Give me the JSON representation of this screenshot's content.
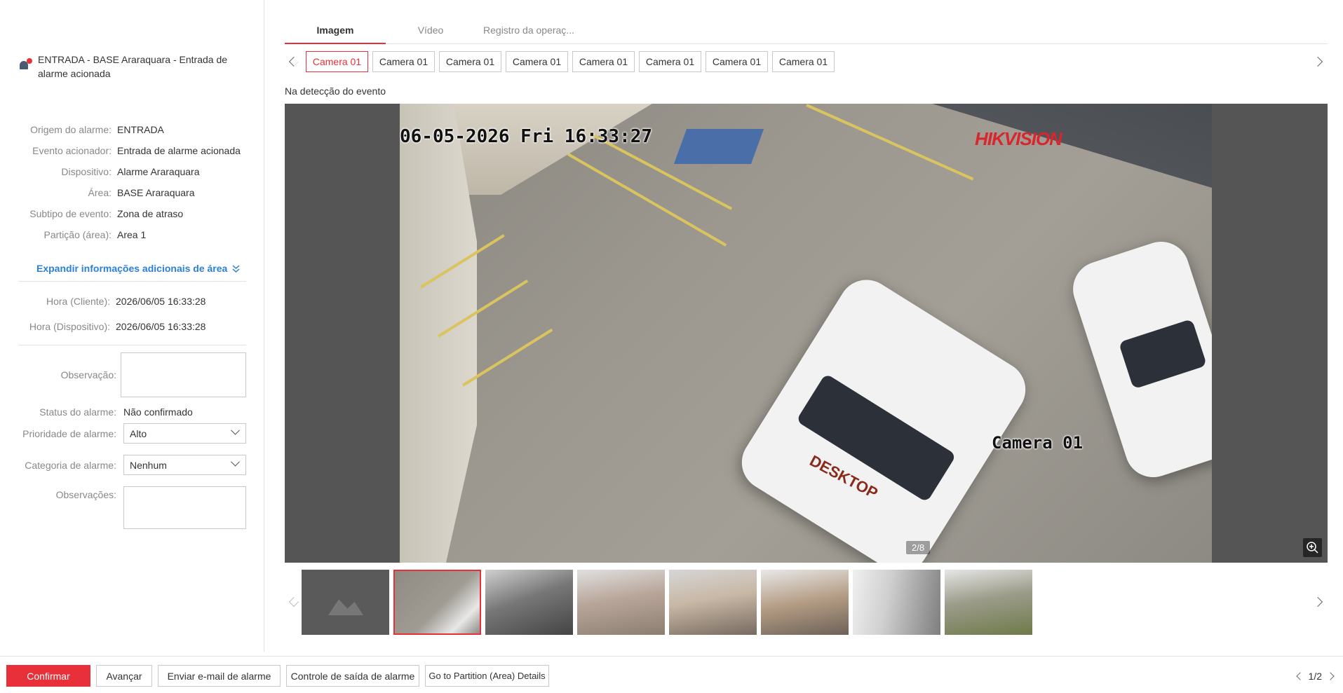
{
  "alarm": {
    "title": "ENTRADA - BASE Araraquara - Entrada de alarme acionada"
  },
  "details": [
    {
      "label": "Origem do alarme:",
      "value": "ENTRADA"
    },
    {
      "label": "Evento acionador:",
      "value": "Entrada de alarme acionada"
    },
    {
      "label": "Dispositivo:",
      "value": "Alarme Araraquara"
    },
    {
      "label": "Área:",
      "value": "BASE Araraquara"
    },
    {
      "label": "Subtipo de evento:",
      "value": "Zona de atraso"
    },
    {
      "label": "Partição (área):",
      "value": "Area 1"
    }
  ],
  "expand_label": "Expandir informações adicionais de área",
  "times": [
    {
      "label": "Hora (Cliente):",
      "value": "2026/06/05 16:33:28"
    },
    {
      "label": "Hora (Dispositivo):",
      "value": "2026/06/05 16:33:28"
    }
  ],
  "form": {
    "observacao_label": "Observação:",
    "status_label": "Status do alarme:",
    "status_value": "Não confirmado",
    "priority_label": "Prioridade de alarme:",
    "priority_value": "Alto",
    "category_label": "Categoria de alarme:",
    "category_value": "Nenhum",
    "observacoes_label": "Observações:"
  },
  "tabs": [
    "Imagem",
    "Vídeo",
    "Registro da operaç..."
  ],
  "active_tab": 0,
  "cameras": [
    "Camera 01",
    "Camera 01",
    "Camera 01",
    "Camera 01",
    "Camera 01",
    "Camera 01",
    "Camera 01",
    "Camera 01"
  ],
  "active_camera": 0,
  "caption": "Na detecção do evento",
  "image": {
    "osd_time": "06-05-2026 Fri 16:33:27",
    "brand": "HIKVISION",
    "osd_camera": "Camera 01",
    "vehicle_logo": "DESKTOP",
    "counter": "2/8"
  },
  "thumbnails_count": 8,
  "active_thumbnail": 1,
  "buttons": {
    "confirm": "Confirmar",
    "advance": "Avançar",
    "email": "Enviar e-mail de alarme",
    "output": "Controle de saída de alarme",
    "partition": "Go to Partition (Area) Details"
  },
  "pager": "1/2",
  "colors": {
    "accent": "#e8303a",
    "link": "#2b7fd6"
  }
}
